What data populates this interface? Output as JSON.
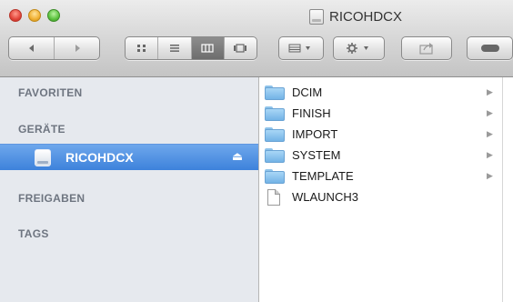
{
  "window": {
    "title": "RICOHDCX"
  },
  "toolbar": {
    "back_icon": "chevron-left",
    "forward_icon": "chevron-right",
    "view_modes": [
      "icon-view",
      "list-view",
      "column-view",
      "cover-flow-view"
    ],
    "active_view": "column-view",
    "arrange_icon": "arrange-grid",
    "action_icon": "gear",
    "share_icon": "share",
    "tag_icon": "toggle"
  },
  "sidebar": {
    "favorites": "FAVORITEN",
    "devices": "GERÄTE",
    "device_item": "RICOHDCX",
    "shared": "FREIGABEN",
    "tags": "TAGS"
  },
  "files": [
    {
      "name": "DCIM",
      "type": "folder",
      "has_children": true
    },
    {
      "name": "FINISH",
      "type": "folder",
      "has_children": true
    },
    {
      "name": "IMPORT",
      "type": "folder",
      "has_children": true
    },
    {
      "name": "SYSTEM",
      "type": "folder",
      "has_children": true
    },
    {
      "name": "TEMPLATE",
      "type": "folder",
      "has_children": true
    },
    {
      "name": "WLAUNCH3",
      "type": "file",
      "has_children": false
    }
  ],
  "colors": {
    "selection": "#4a8ce0",
    "sidebar_bg": "#e6e9ee"
  }
}
